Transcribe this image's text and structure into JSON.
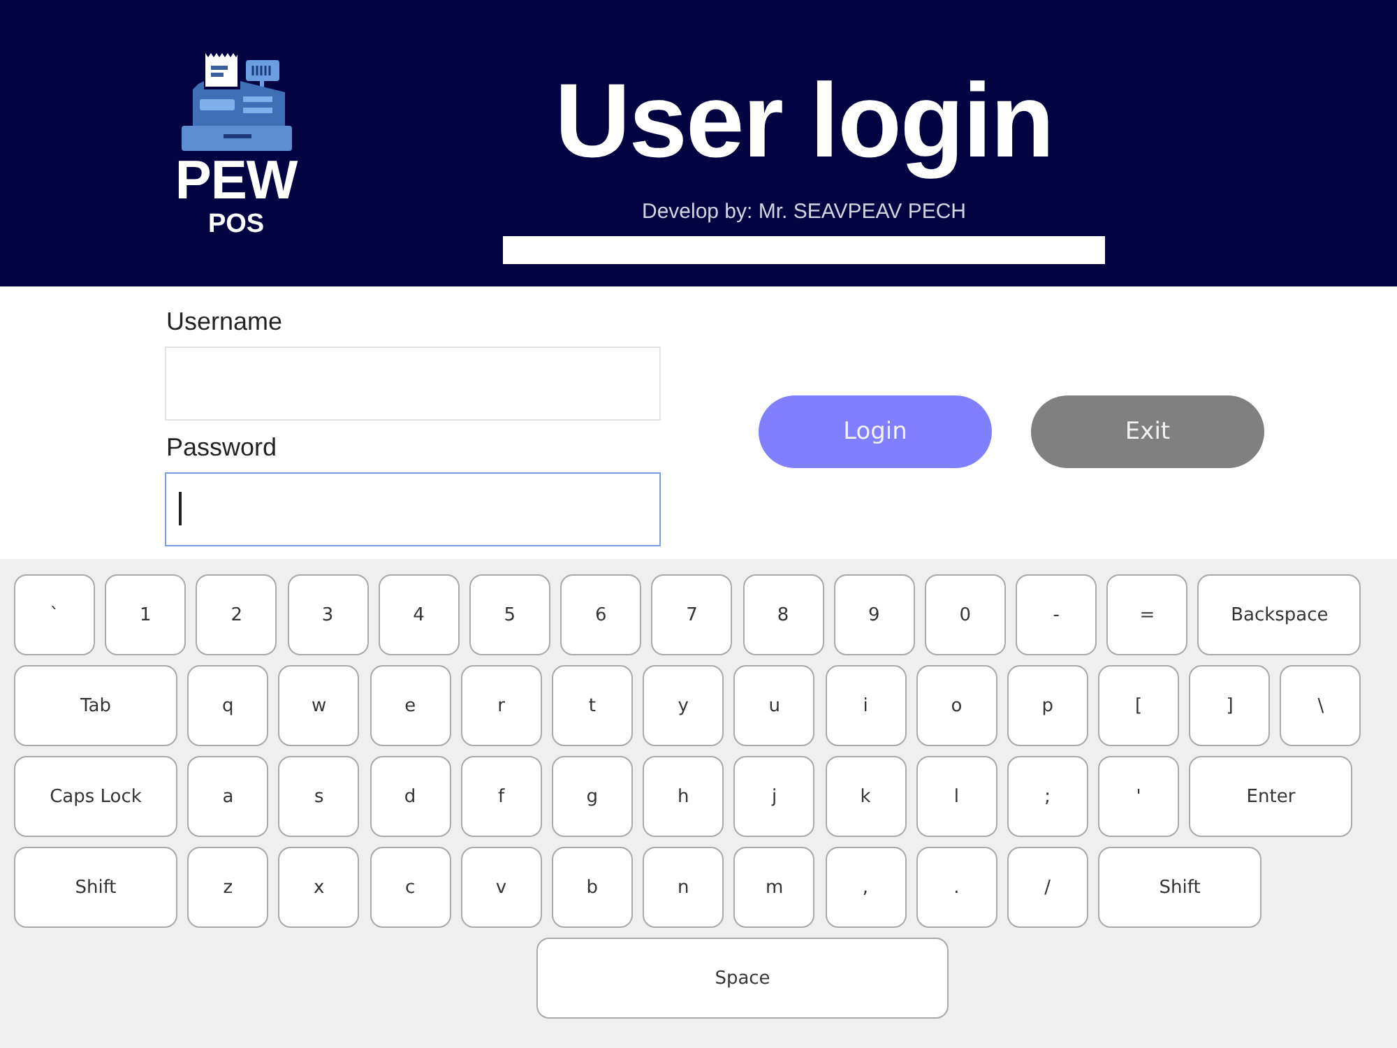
{
  "header": {
    "logo": {
      "name": "PEW",
      "subtitle": "POS"
    },
    "title": "User login",
    "developer": "Develop by: Mr. SEAVPEAV PECH"
  },
  "form": {
    "fields": [
      {
        "label": "Username",
        "focused": false
      },
      {
        "label": "Password",
        "focused": true
      }
    ],
    "buttons": [
      {
        "label": "Login",
        "kind": "primary"
      },
      {
        "label": "Exit",
        "kind": "secondary"
      }
    ]
  },
  "keyboard": {
    "rows": [
      [
        {
          "label": "`",
          "kind": "char"
        },
        {
          "label": "1",
          "kind": "char"
        },
        {
          "label": "2",
          "kind": "char"
        },
        {
          "label": "3",
          "kind": "char"
        },
        {
          "label": "4",
          "kind": "char"
        },
        {
          "label": "5",
          "kind": "char"
        },
        {
          "label": "6",
          "kind": "char"
        },
        {
          "label": "7",
          "kind": "char"
        },
        {
          "label": "8",
          "kind": "char"
        },
        {
          "label": "9",
          "kind": "char"
        },
        {
          "label": "0",
          "kind": "char"
        },
        {
          "label": "-",
          "kind": "char"
        },
        {
          "label": "=",
          "kind": "char"
        },
        {
          "label": "Backspace",
          "kind": "wide"
        }
      ],
      [
        {
          "label": "Tab",
          "kind": "wide"
        },
        {
          "label": "q",
          "kind": "char"
        },
        {
          "label": "w",
          "kind": "char"
        },
        {
          "label": "e",
          "kind": "char"
        },
        {
          "label": "r",
          "kind": "char"
        },
        {
          "label": "t",
          "kind": "char"
        },
        {
          "label": "y",
          "kind": "char"
        },
        {
          "label": "u",
          "kind": "char"
        },
        {
          "label": "i",
          "kind": "char"
        },
        {
          "label": "o",
          "kind": "char"
        },
        {
          "label": "p",
          "kind": "char"
        },
        {
          "label": "[",
          "kind": "char"
        },
        {
          "label": "]",
          "kind": "char"
        },
        {
          "label": "\\",
          "kind": "char"
        }
      ],
      [
        {
          "label": "Caps Lock",
          "kind": "wide"
        },
        {
          "label": "a",
          "kind": "char"
        },
        {
          "label": "s",
          "kind": "char"
        },
        {
          "label": "d",
          "kind": "char"
        },
        {
          "label": "f",
          "kind": "char"
        },
        {
          "label": "g",
          "kind": "char"
        },
        {
          "label": "h",
          "kind": "char"
        },
        {
          "label": "j",
          "kind": "char"
        },
        {
          "label": "k",
          "kind": "char"
        },
        {
          "label": "l",
          "kind": "char"
        },
        {
          "label": ";",
          "kind": "char"
        },
        {
          "label": "'",
          "kind": "char"
        },
        {
          "label": "Enter",
          "kind": "wide"
        }
      ],
      [
        {
          "label": "Shift",
          "kind": "wide"
        },
        {
          "label": "z",
          "kind": "char"
        },
        {
          "label": "x",
          "kind": "char"
        },
        {
          "label": "c",
          "kind": "char"
        },
        {
          "label": "v",
          "kind": "char"
        },
        {
          "label": "b",
          "kind": "char"
        },
        {
          "label": "n",
          "kind": "char"
        },
        {
          "label": "m",
          "kind": "char"
        },
        {
          "label": ",",
          "kind": "char"
        },
        {
          "label": ".",
          "kind": "char"
        },
        {
          "label": "/",
          "kind": "char"
        },
        {
          "label": "Shift",
          "kind": "wide"
        }
      ],
      [
        {
          "label": "Space",
          "kind": "space"
        }
      ]
    ]
  }
}
